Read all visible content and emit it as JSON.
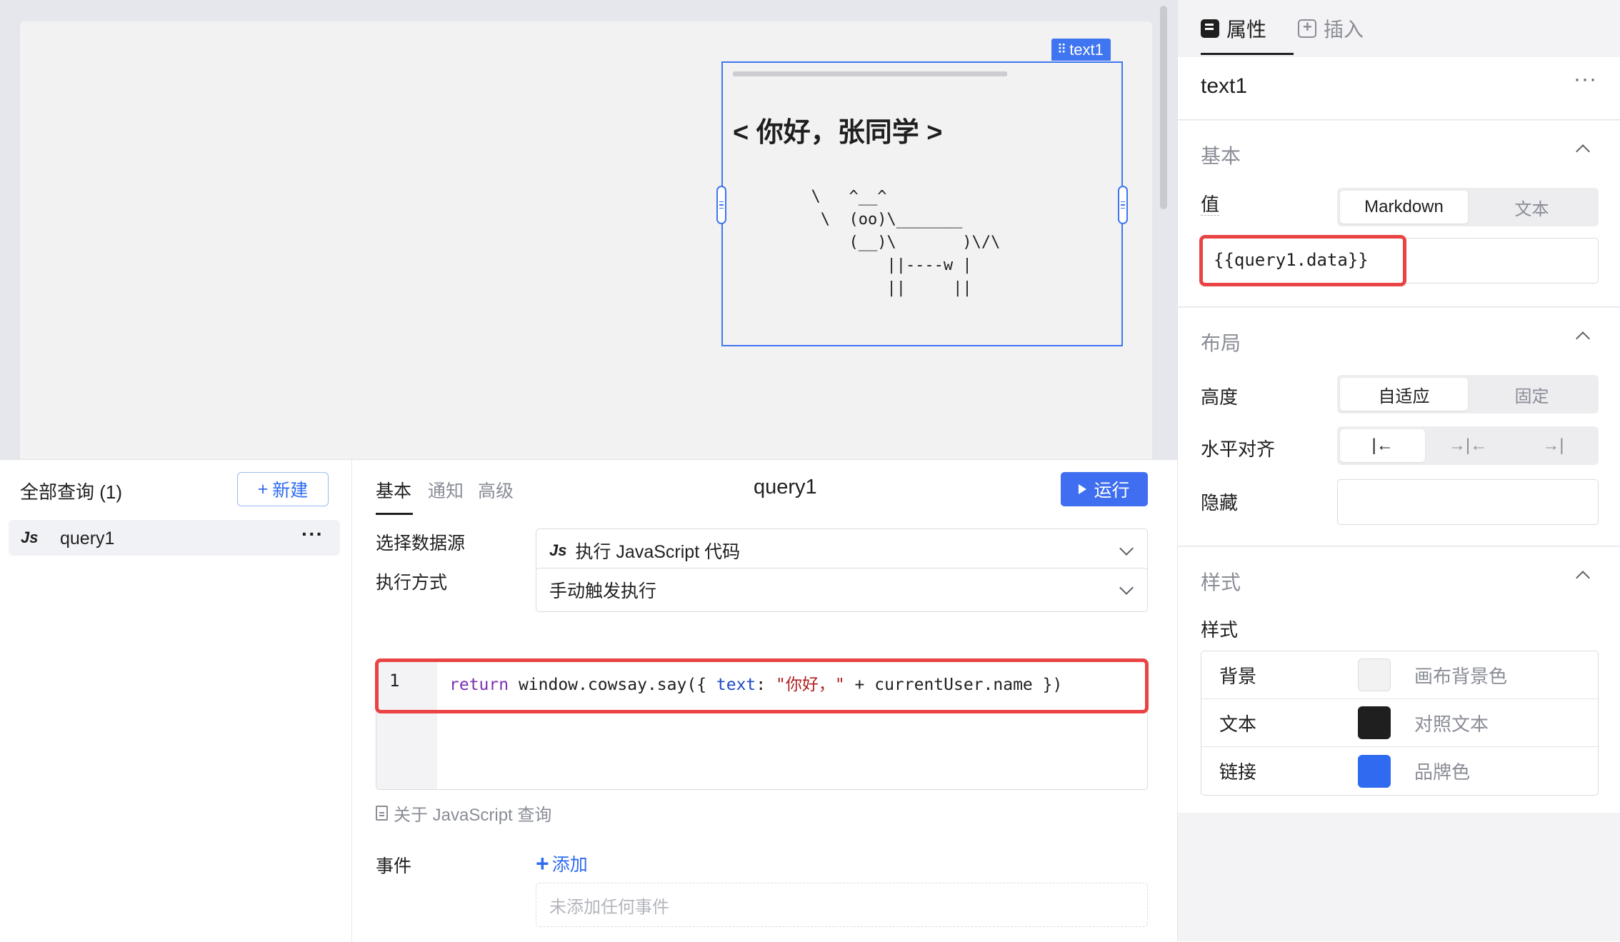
{
  "canvas": {
    "component_tag": "text1",
    "greeting": "< 你好，张同学 >",
    "cow_ascii": "  \\   ^__^\n   \\  (oo)\\_______\n      (__)\\       )\\/\\\n          ||----w |\n          ||     ||"
  },
  "query_list": {
    "title": "全部查询 (1)",
    "new_button": "新建",
    "items": [
      {
        "type_badge": "Js",
        "name": "query1"
      }
    ]
  },
  "query_editor": {
    "tabs": [
      "基本",
      "通知",
      "高级"
    ],
    "active_tab": "基本",
    "title": "query1",
    "run_button": "运行",
    "datasource_label": "选择数据源",
    "datasource_badge": "Js",
    "datasource_value": "执行 JavaScript 代码",
    "mode_label": "执行方式",
    "mode_value": "手动触发执行",
    "code": {
      "line_number": "1",
      "keyword": "return",
      "part1": " window.cowsay.say({ ",
      "prop": "text",
      "part2": ": ",
      "string": "\"你好，\"",
      "part3": " + currentUser.name })"
    },
    "doc_link": "关于 JavaScript 查询",
    "events_label": "事件",
    "add_event": "添加",
    "events_empty": "未添加任何事件"
  },
  "right_panel": {
    "tabs": {
      "properties": "属性",
      "insert": "插入"
    },
    "component_name": "text1",
    "basic": {
      "title": "基本",
      "value_label": "值",
      "value_modes": [
        "Markdown",
        "文本"
      ],
      "value_mode_selected": "Markdown",
      "value": "{{query1.data}}"
    },
    "layout": {
      "title": "布局",
      "height_label": "高度",
      "height_options": [
        "自适应",
        "固定"
      ],
      "height_selected": "自适应",
      "halign_label": "水平对齐",
      "halign_selected": "left",
      "hide_label": "隐藏"
    },
    "style": {
      "title": "样式",
      "sub_label": "样式",
      "rows": [
        {
          "name": "背景",
          "value": "画布背景色",
          "color": "#f2f2f3"
        },
        {
          "name": "文本",
          "value": "对照文本",
          "color": "#1f1f1f"
        },
        {
          "name": "链接",
          "value": "品牌色",
          "color": "#2f6bf0"
        }
      ]
    }
  },
  "colors": {
    "accent": "#3f6ff0",
    "highlight_red": "#ea4343",
    "selection_blue": "#3f75f0"
  }
}
